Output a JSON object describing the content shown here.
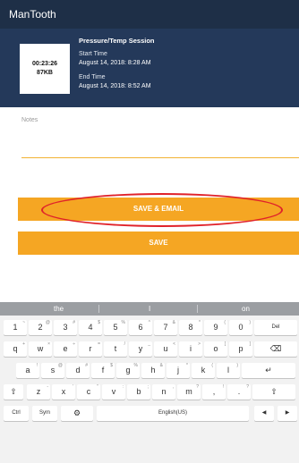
{
  "app": {
    "title": "ManTooth"
  },
  "session": {
    "duration": "00:23:26",
    "size": "87KB",
    "title": "Pressure/Temp Session",
    "start_label": "Start Time",
    "start_value": "August 14, 2018: 8:28 AM",
    "end_label": "End Time",
    "end_value": "August 14, 2018: 8:52 AM"
  },
  "notes": {
    "label": "Notes"
  },
  "buttons": {
    "save_email": "SAVE & EMAIL",
    "save": "SAVE"
  },
  "highlight_color": "#e0222a",
  "accent_color": "#f5a623",
  "keyboard": {
    "suggestions": [
      "the",
      "I",
      "on"
    ],
    "row1": [
      {
        "k": "1",
        "s": "~"
      },
      {
        "k": "2",
        "s": "@"
      },
      {
        "k": "3",
        "s": "#"
      },
      {
        "k": "4",
        "s": "$"
      },
      {
        "k": "5",
        "s": "%"
      },
      {
        "k": "6",
        "s": "^"
      },
      {
        "k": "7",
        "s": "&"
      },
      {
        "k": "8",
        "s": "*"
      },
      {
        "k": "9",
        "s": "("
      },
      {
        "k": "0",
        "s": ")"
      }
    ],
    "del_label": "Del",
    "row2": [
      {
        "k": "q",
        "s": "+"
      },
      {
        "k": "w",
        "s": "×"
      },
      {
        "k": "e",
        "s": "÷"
      },
      {
        "k": "r",
        "s": "="
      },
      {
        "k": "t",
        "s": "/"
      },
      {
        "k": "y",
        "s": "_"
      },
      {
        "k": "u",
        "s": "<"
      },
      {
        "k": "i",
        "s": ">"
      },
      {
        "k": "o",
        "s": "["
      },
      {
        "k": "p",
        "s": "]"
      }
    ],
    "row3": [
      {
        "k": "a",
        "s": "!"
      },
      {
        "k": "s",
        "s": "@"
      },
      {
        "k": "d",
        "s": "#"
      },
      {
        "k": "f",
        "s": "$"
      },
      {
        "k": "g",
        "s": "%"
      },
      {
        "k": "h",
        "s": "&"
      },
      {
        "k": "j",
        "s": "*"
      },
      {
        "k": "k",
        "s": "("
      },
      {
        "k": "l",
        "s": ")"
      }
    ],
    "row4": [
      {
        "k": "z",
        "s": "-"
      },
      {
        "k": "x",
        "s": "'"
      },
      {
        "k": "c",
        "s": "\""
      },
      {
        "k": "v",
        "s": ":"
      },
      {
        "k": "b",
        "s": ";"
      },
      {
        "k": "n",
        "s": ","
      },
      {
        "k": "m",
        "s": "?"
      },
      {
        "k": ",",
        "s": "!"
      },
      {
        "k": ".",
        "s": "?"
      }
    ],
    "ctrl_label": "Ctrl",
    "sym_label": "Sym",
    "space_label": "English(US)"
  }
}
